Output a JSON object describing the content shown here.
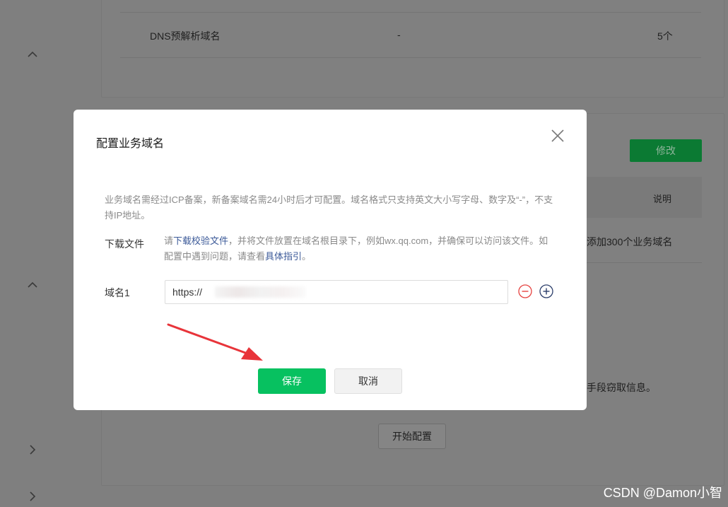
{
  "background": {
    "dns_row": {
      "name": "DNS预解析域名",
      "value": "-",
      "count": "5个"
    },
    "modify_button": "修改",
    "table_header_desc": "说明",
    "table_cell_desc": "添加300个业务域名",
    "notice_fragment": "手段窃取信息。",
    "start_config_button": "开始配置"
  },
  "modal": {
    "title": "配置业务域名",
    "description": "业务域名需经过ICP备案，新备案域名需24小时后才可配置。域名格式只支持英文大小写字母、数字及“-”，不支持IP地址。",
    "download": {
      "label": "下载文件",
      "prefix": "请",
      "link_file": "下载校验文件",
      "middle": "，并将文件放置在域名根目录下，例如wx.qq.com，并确保可以访问该文件。如配置中遇到问题，请查看",
      "link_guide": "具体指引",
      "suffix": "。"
    },
    "domain": {
      "label": "域名1",
      "value": "https://"
    },
    "save_button": "保存",
    "cancel_button": "取消"
  },
  "watermark": "CSDN @Damon小智",
  "colors": {
    "primary_green": "#07c160",
    "link_blue": "#3b5998",
    "remove_red": "#e64340",
    "arrow_red": "#e8343a"
  },
  "icons": {
    "close": "close-icon",
    "remove": "minus-circle-icon",
    "add": "plus-circle-icon"
  }
}
